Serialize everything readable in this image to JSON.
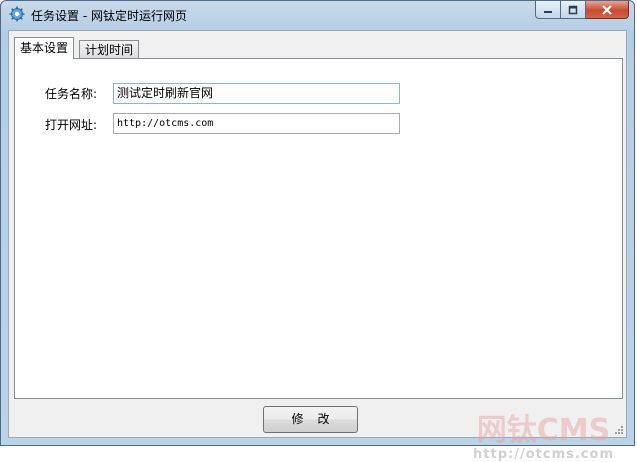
{
  "window": {
    "title": "任务设置 - 网钛定时运行网页",
    "icon": "gear-app-icon",
    "controls": {
      "minimize": "minimize-icon",
      "maximize": "maximize-icon",
      "close": "close-icon"
    }
  },
  "tabs": [
    {
      "label": "基本设置",
      "active": true
    },
    {
      "label": "计划时间",
      "active": false
    }
  ],
  "form": {
    "name_label": "任务名称:",
    "name_value": "测试定时刷新官网",
    "url_label": "打开网址:",
    "url_value": "http://otcms.com"
  },
  "footer": {
    "modify_label": "修改"
  },
  "watermark": {
    "brand": "网钛CMS",
    "url": "http://otcms.com"
  },
  "colors": {
    "accent_border": "#8eb4d4",
    "close_red": "#c74a33",
    "titlebar": "#bcd2e6"
  }
}
